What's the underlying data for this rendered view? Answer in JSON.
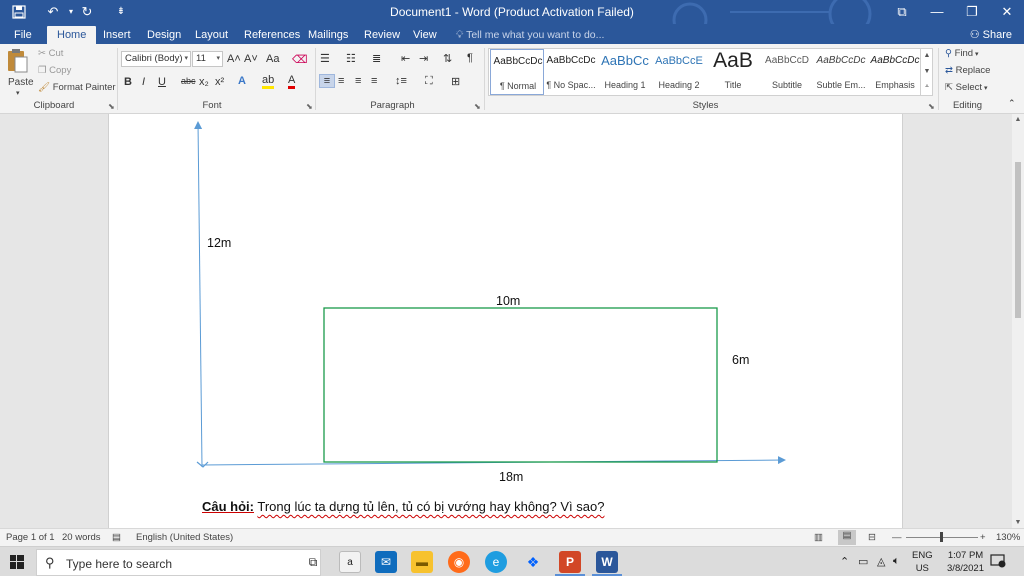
{
  "titlebar": {
    "title": "Document1 - Word (Product Activation Failed)",
    "save_icon": "save-icon",
    "undo_glyph": "↶",
    "redo_glyph": "↻",
    "customize_glyph": "⇟",
    "restore_glyph": "⧉",
    "minimize_glyph": "—",
    "maximize_glyph": "❐",
    "close_glyph": "✕"
  },
  "tabs": {
    "file": "File",
    "home": "Home",
    "insert": "Insert",
    "design": "Design",
    "layout": "Layout",
    "references": "References",
    "mailings": "Mailings",
    "review": "Review",
    "view": "View",
    "tell_me": "Tell me what you want to do...",
    "share": "Share"
  },
  "clipboard": {
    "paste": "Paste",
    "cut": "Cut",
    "copy": "Copy",
    "format_painter": "Format Painter",
    "label": "Clipboard"
  },
  "font": {
    "name": "Calibri (Body)",
    "size": "11",
    "label": "Font",
    "bold": "B",
    "italic": "I",
    "underline": "U",
    "strike": "abc",
    "subscript": "x₂",
    "superscript": "x²",
    "grow": "A˄",
    "shrink": "A˅",
    "case": "Aa",
    "effects": "A",
    "highlight": "ab",
    "color": "A"
  },
  "paragraph": {
    "label": "Paragraph",
    "pilcrow": "¶"
  },
  "styles": {
    "label": "Styles",
    "items": [
      {
        "preview": "AaBbCcDc",
        "name": "¶ Normal"
      },
      {
        "preview": "AaBbCcDc",
        "name": "¶ No Spac..."
      },
      {
        "preview": "AaBbCc",
        "name": "Heading 1"
      },
      {
        "preview": "AaBbCcE",
        "name": "Heading 2"
      },
      {
        "preview": "AaB",
        "name": "Title"
      },
      {
        "preview": "AaBbCcD",
        "name": "Subtitle"
      },
      {
        "preview": "AaBbCcDc",
        "name": "Subtle Em..."
      },
      {
        "preview": "AaBbCcDc",
        "name": "Emphasis"
      }
    ]
  },
  "editing": {
    "find": "Find",
    "replace": "Replace",
    "select": "Select",
    "label": "Editing"
  },
  "document": {
    "label_12m": "12m",
    "label_10m": "10m",
    "label_6m": "6m",
    "label_18m": "18m",
    "question_bold": "Câu hỏi:",
    "question_text": "Trong lúc ta dựng tủ lên, tủ có bị vướng hay không? Vì sao?"
  },
  "statusbar": {
    "page": "Page 1 of 1",
    "words": "20 words",
    "language": "English (United States)",
    "zoom": "130%"
  },
  "taskbar": {
    "search_placeholder": "Type here to search",
    "lang_top": "ENG",
    "lang_bottom": "US",
    "time": "1:07 PM",
    "date": "3/8/2021"
  },
  "colors": {
    "word_blue": "#2b579a",
    "rect_green": "#1a9a4a",
    "axis_blue": "#5b9bd5"
  }
}
